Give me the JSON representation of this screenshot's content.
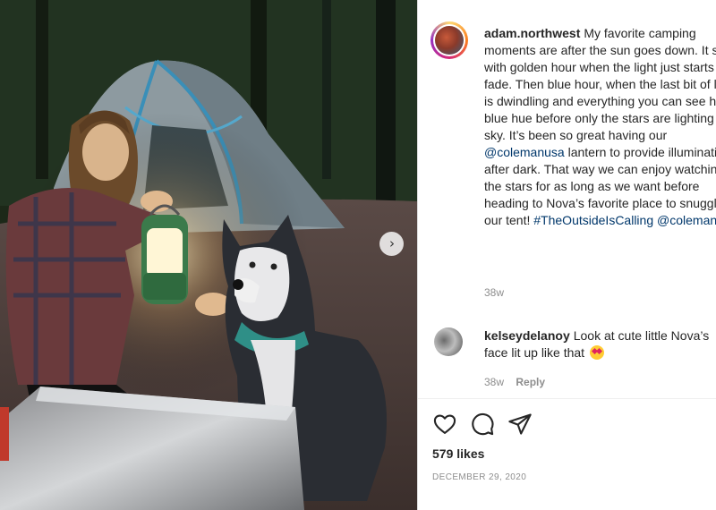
{
  "post": {
    "username": "adam.northwest",
    "caption": "My favorite camping moments are after the sun goes down. It starts with golden hour when the light just starts to fade. Then blue hour, when the last bit of light is dwindling and everything you can see has a blue hue before only the stars are lighting the sky. It’s been so great having our",
    "mention_1": "@colemanusa",
    "caption_2": "lantern to provide illumination after dark. That way we can enjoy watching the stars for as long as we want before heading to Nova’s favorite place to snuggle, our tent!",
    "hashtag": "#TheOutsideIsCalling",
    "mention_2": "@colemanusa",
    "time": "38w"
  },
  "comment": {
    "username": "kelseydelanoy",
    "text": "Look at cute little Nova’s face lit up like that",
    "emoji": "heart-eyes-emoji",
    "time": "38w",
    "reply_label": "Reply"
  },
  "actions": {
    "like_icon": "heart-icon",
    "comment_icon": "comment-icon",
    "share_icon": "share-icon"
  },
  "likes": "579 likes",
  "date": "DECEMBER 29, 2020",
  "photo": {
    "next_icon": "chevron-right-icon"
  },
  "colors": {
    "text": "#262626",
    "link": "#00376b",
    "muted": "#8e8e8e"
  }
}
